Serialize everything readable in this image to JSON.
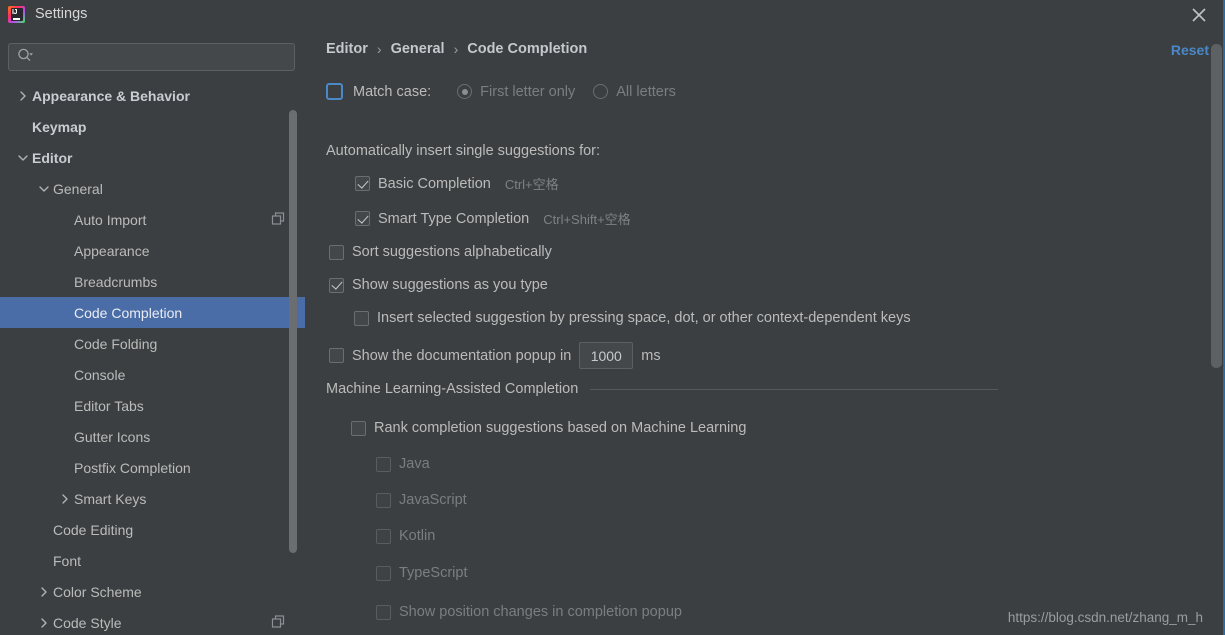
{
  "window": {
    "title": "Settings",
    "app_icon": "intellij-idea-logo",
    "close_icon": "close-icon"
  },
  "sidebar": {
    "search": {
      "placeholder": "",
      "value": "",
      "icon": "search-icon"
    },
    "items": [
      {
        "label": "Appearance & Behavior",
        "depth": 0,
        "arrow": "collapsed",
        "bold": true,
        "selected": false,
        "project_icon": false
      },
      {
        "label": "Keymap",
        "depth": 0,
        "arrow": "none",
        "bold": true,
        "selected": false,
        "project_icon": false
      },
      {
        "label": "Editor",
        "depth": 0,
        "arrow": "expanded",
        "bold": true,
        "selected": false,
        "project_icon": false
      },
      {
        "label": "General",
        "depth": 1,
        "arrow": "expanded",
        "bold": false,
        "selected": false,
        "project_icon": false
      },
      {
        "label": "Auto Import",
        "depth": 2,
        "arrow": "none",
        "bold": false,
        "selected": false,
        "project_icon": true
      },
      {
        "label": "Appearance",
        "depth": 2,
        "arrow": "none",
        "bold": false,
        "selected": false,
        "project_icon": false
      },
      {
        "label": "Breadcrumbs",
        "depth": 2,
        "arrow": "none",
        "bold": false,
        "selected": false,
        "project_icon": false
      },
      {
        "label": "Code Completion",
        "depth": 2,
        "arrow": "none",
        "bold": false,
        "selected": true,
        "project_icon": false
      },
      {
        "label": "Code Folding",
        "depth": 2,
        "arrow": "none",
        "bold": false,
        "selected": false,
        "project_icon": false
      },
      {
        "label": "Console",
        "depth": 2,
        "arrow": "none",
        "bold": false,
        "selected": false,
        "project_icon": false
      },
      {
        "label": "Editor Tabs",
        "depth": 2,
        "arrow": "none",
        "bold": false,
        "selected": false,
        "project_icon": false
      },
      {
        "label": "Gutter Icons",
        "depth": 2,
        "arrow": "none",
        "bold": false,
        "selected": false,
        "project_icon": false
      },
      {
        "label": "Postfix Completion",
        "depth": 2,
        "arrow": "none",
        "bold": false,
        "selected": false,
        "project_icon": false
      },
      {
        "label": "Smart Keys",
        "depth": 2,
        "arrow": "collapsed",
        "bold": false,
        "selected": false,
        "project_icon": false
      },
      {
        "label": "Code Editing",
        "depth": 1,
        "arrow": "none",
        "bold": false,
        "selected": false,
        "project_icon": false
      },
      {
        "label": "Font",
        "depth": 1,
        "arrow": "none",
        "bold": false,
        "selected": false,
        "project_icon": false
      },
      {
        "label": "Color Scheme",
        "depth": 1,
        "arrow": "collapsed",
        "bold": false,
        "selected": false,
        "project_icon": false
      },
      {
        "label": "Code Style",
        "depth": 1,
        "arrow": "collapsed",
        "bold": false,
        "selected": false,
        "project_icon": true
      }
    ]
  },
  "main": {
    "breadcrumb": {
      "items": [
        "Editor",
        "General",
        "Code Completion"
      ],
      "separator": "›"
    },
    "reset_label": "Reset",
    "match_case": {
      "label": "Match case:",
      "checked": false,
      "focused": true,
      "radios": [
        {
          "label": "First letter only",
          "selected": true
        },
        {
          "label": "All letters",
          "selected": false
        }
      ]
    },
    "auto_insert_header": "Automatically insert single suggestions for:",
    "auto_insert_options": [
      {
        "label": "Basic Completion",
        "shortcut": "Ctrl+空格",
        "checked": true
      },
      {
        "label": "Smart Type Completion",
        "shortcut": "Ctrl+Shift+空格",
        "checked": true
      }
    ],
    "sort_alphabetically": {
      "label": "Sort suggestions alphabetically",
      "checked": false
    },
    "show_as_you_type": {
      "label": "Show suggestions as you type",
      "checked": true
    },
    "insert_selected": {
      "label": "Insert selected suggestion by pressing space, dot, or other context-dependent keys",
      "checked": false
    },
    "doc_popup": {
      "label_before": "Show the documentation popup in",
      "value": "1000",
      "unit": "ms",
      "checked": false
    },
    "ml_section": {
      "title": "Machine Learning-Assisted Completion",
      "rank_option": {
        "label": "Rank completion suggestions based on Machine Learning",
        "checked": false
      },
      "languages": [
        {
          "label": "Java",
          "checked": false,
          "enabled": false
        },
        {
          "label": "JavaScript",
          "checked": false,
          "enabled": false
        },
        {
          "label": "Kotlin",
          "checked": false,
          "enabled": false
        },
        {
          "label": "TypeScript",
          "checked": false,
          "enabled": false
        }
      ],
      "show_position_changes": {
        "label": "Show position changes in completion popup",
        "checked": false,
        "enabled": false
      }
    }
  },
  "watermark": "https://blog.csdn.net/zhang_m_h",
  "colors": {
    "background": "#3c3f41",
    "selection": "#4a6da7",
    "link": "#4a88c7",
    "text": "#bbbbbb",
    "disabled_text": "#7b7e80"
  }
}
